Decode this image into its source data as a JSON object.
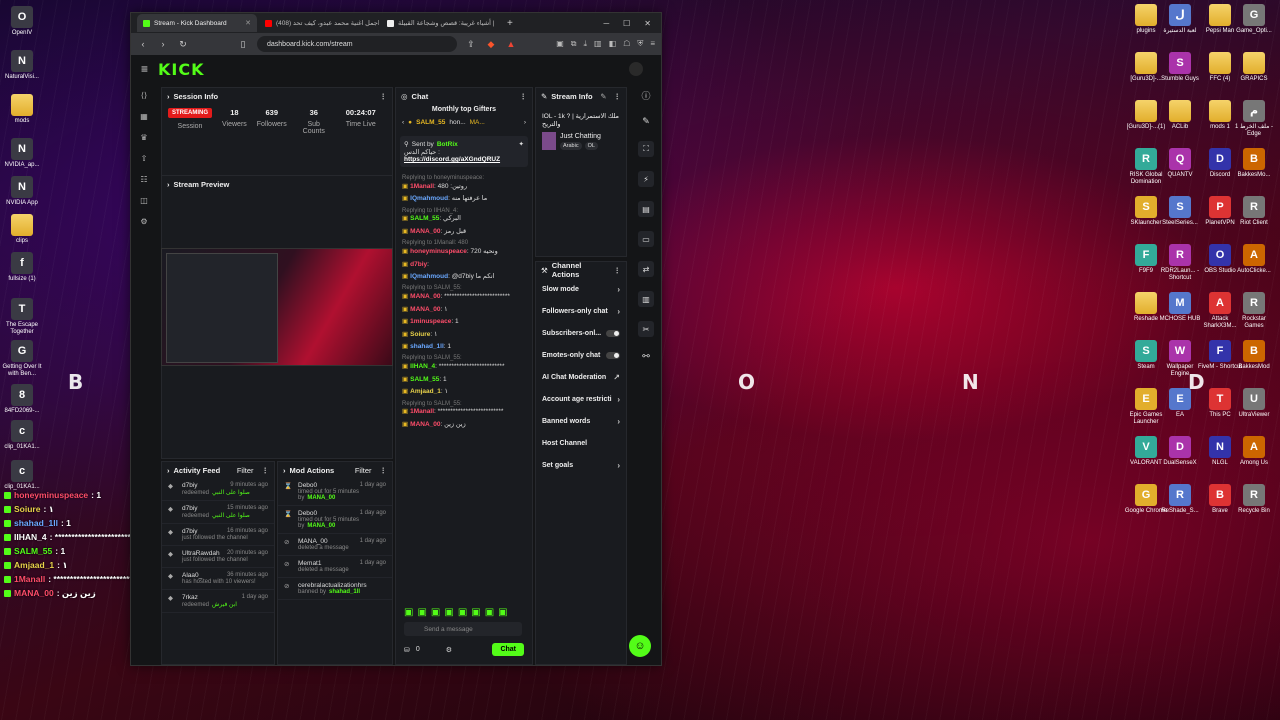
{
  "browser": {
    "tabs": [
      {
        "title": "Stream - Kick Dashboard",
        "favicon_color": "#53fc18",
        "active": true
      },
      {
        "title": "(408) اجمل اغنية محمد عبدو، كيف تحد",
        "favicon_color": "#ff0000",
        "active": false
      },
      {
        "title": "أشياء غريبة: قصص وشجاعة القبيلة |",
        "favicon_color": "#eeeeee",
        "active": false
      }
    ],
    "new_tab": "+",
    "url": "dashboard.kick.com/stream"
  },
  "kick": {
    "logo": "KICK",
    "session": {
      "title": "Session Info",
      "status": "STREAMING",
      "status_label": "Session",
      "viewers": "18",
      "viewers_label": "Viewers",
      "followers": "639",
      "followers_label": "Followers",
      "subs": "36",
      "subs_label": "Sub Counts",
      "time": "00:24:07",
      "time_label": "Time Live"
    },
    "preview_title": "Stream Preview",
    "activity": {
      "title": "Activity Feed",
      "filter": "Filter",
      "rows": [
        {
          "user": "d7biy",
          "text": "redeemed",
          "extra": "صلوا على النبي",
          "meta": "9 minutes ago"
        },
        {
          "user": "d7biy",
          "text": "redeemed",
          "extra": "صلوا على النبي",
          "meta": "15 minutes ago"
        },
        {
          "user": "d7biy",
          "text": "just followed the channel",
          "extra": "",
          "meta": "16 minutes ago"
        },
        {
          "user": "UltraRawdah",
          "text": "just followed the channel",
          "extra": "",
          "meta": "20 minutes ago"
        },
        {
          "user": "Alaa0_",
          "text": "has hosted with 10 viewers!",
          "extra": "",
          "meta": "36 minutes ago"
        },
        {
          "user": "7rkaz",
          "text": "redeemed",
          "extra": "ابن فيرش",
          "meta": "1 day ago"
        }
      ]
    },
    "mod": {
      "title": "Mod Actions",
      "filter": "Filter",
      "rows": [
        {
          "user": "Debo0",
          "text": "timed out for 5 minutes by",
          "by": "MANA_00",
          "meta": "1 day ago"
        },
        {
          "user": "Debo0",
          "text": "timed out for 5 minutes by",
          "by": "MANA_00",
          "meta": "1 day ago"
        },
        {
          "user": "MANA_00",
          "text": "deleted a message",
          "by": "",
          "meta": "1 day ago"
        },
        {
          "user": "Memat1",
          "text": "deleted a message",
          "by": "",
          "meta": "1 day ago"
        },
        {
          "user": "cerebralactualizationhrs",
          "text": "banned by",
          "by": "shahad_1ll",
          "meta": ""
        }
      ]
    },
    "chat": {
      "title": "Chat",
      "gifters_title": "Monthly top Gifters",
      "gifters": [
        "SALM_55",
        "hon...",
        "MA..."
      ],
      "pinned_by": "Sent by",
      "pinned_user": "BotRix",
      "pinned_text": "حياكم الدس :",
      "pinned_link": "https://discord.gg/aXGndQRUZ",
      "messages": [
        {
          "reply": "Replying to honeyminuspeace:",
          "user": "1Manall",
          "cls": "u-red",
          "text": "480 :روتين"
        },
        {
          "reply": "",
          "user": "IQmahmoud",
          "cls": "u-blue",
          "text": "ما عرفتها منه"
        },
        {
          "reply": "Replying to IIHAN_4:",
          "user": "SALM_55",
          "cls": "u-green",
          "text": "البركي"
        },
        {
          "reply": "",
          "user": "MANA_00",
          "cls": "u-red",
          "text": "قبل رمز"
        },
        {
          "reply": "Replying to 1Manall: 480",
          "user": "honeyminuspeace",
          "cls": "u-red",
          "text": "720 ونحيه"
        },
        {
          "reply": "",
          "user": "d7biy",
          "cls": "u-red",
          "text": ""
        },
        {
          "reply": "",
          "user": "IQmahmoud",
          "cls": "u-blue",
          "text": "@d7biy انكم ما"
        },
        {
          "reply": "Replying to SALM_55:",
          "user": "MANA_00",
          "cls": "u-red",
          "text": "**************************"
        },
        {
          "reply": "",
          "user": "MANA_00",
          "cls": "u-red",
          "text": "١"
        },
        {
          "reply": "",
          "user": "1minuspeace",
          "cls": "u-red",
          "text": "1"
        },
        {
          "reply": "",
          "user": "Soiure",
          "cls": "u-yellow",
          "text": "١"
        },
        {
          "reply": "",
          "user": "shahad_1ll",
          "cls": "u-blue",
          "text": "1"
        },
        {
          "reply": "Replying to SALM_55:",
          "user": "IIHAN_4",
          "cls": "u-green",
          "text": "**************************"
        },
        {
          "reply": "",
          "user": "SALM_55",
          "cls": "u-green",
          "text": "1"
        },
        {
          "reply": "",
          "user": "Amjaad_1",
          "cls": "u-yellow",
          "text": "١"
        },
        {
          "reply": "Replying to SALM_55:",
          "user": "1Manall",
          "cls": "u-red",
          "text": "**************************"
        },
        {
          "reply": "",
          "user": "MANA_00",
          "cls": "u-red",
          "text": "زين زين"
        }
      ],
      "input_placeholder": "Send a message",
      "points": "0",
      "send_label": "Chat"
    },
    "stream_info": {
      "title": "Stream Info",
      "stream_title": "IOL - 1k ? | ملك الاستمرارية",
      "stream_sub": "والتريح",
      "category": "Just Chatting",
      "tags": [
        "Arabic",
        "OL"
      ]
    },
    "channel_actions": {
      "title": "Channel Actions",
      "items": [
        {
          "label": "Slow mode",
          "control": "chevron"
        },
        {
          "label": "Followers-only chat",
          "control": "chevron"
        },
        {
          "label": "Subscribers-onl...",
          "control": "toggle"
        },
        {
          "label": "Emotes-only chat",
          "control": "toggle"
        },
        {
          "label": "AI Chat Moderation",
          "control": "link"
        },
        {
          "label": "Account age restricti",
          "control": "chevron"
        },
        {
          "label": "Banned words",
          "control": "chevron"
        },
        {
          "label": "Host Channel",
          "control": "none"
        },
        {
          "label": "Set goals",
          "control": "chevron"
        }
      ]
    }
  },
  "desktop": {
    "left_icons": [
      "OpenIV",
      "NaturalVisi...",
      "mods",
      "NVIDIA_ap...",
      "NVIDIA App",
      "clips",
      "fullsize (1)",
      "The Escape Together",
      "Getting Over It with Ben...",
      "84FD2069-...",
      "clip_01KA1...",
      "clip_01KA1..."
    ],
    "right_icons": [
      "plugins",
      "لعبة الدستيرة",
      "Pepsi Man",
      "Game_Opti...",
      "[Guru3D]-...",
      "Stumble Guys",
      "FFC (4)",
      "GRAPICS",
      "[Guru3D]-...(1)",
      "ACLib",
      "mods 1",
      "ملف الخرط 1 - Edge",
      "RISK Global Domination",
      "QUANTV",
      "Discord",
      "BakkesMo...",
      "SKlauncher",
      "SteelSeries...",
      "PlanetVPN",
      "Riot Client",
      "F9F9",
      "RDR2Laun... - Shortcut",
      "OBS Studio",
      "AutoClicke...",
      "Reshade",
      "MCHOSE HUB",
      "Attack SharkX3M...",
      "Rockstar Games",
      "Steam",
      "Wallpaper Engine",
      "FiveM - Shortcut",
      "BakkesMod",
      "Epic Games Launcher",
      "EA",
      "This PC",
      "UltraViewer",
      "VALORANT",
      "DualSenseX",
      "NLGL",
      "Among Us",
      "Google Chrome",
      "ReShade_S...",
      "Brave",
      "Recycle Bin"
    ],
    "wall_letters": [
      "B",
      "O",
      "N",
      "D"
    ]
  },
  "overlay": {
    "lines": [
      {
        "user": "honeyminuspeace",
        "text": ": 1"
      },
      {
        "user": "Soiure",
        "text": ": ١"
      },
      {
        "user": "shahad_1ll",
        "text": ": 1"
      },
      {
        "user": "IIHAN_4",
        "text": ": **************************"
      },
      {
        "user": "SALM_55",
        "text": ": 1"
      },
      {
        "user": "Amjaad_1",
        "text": ": ١"
      },
      {
        "user": "1Manall",
        "text": ": **************************"
      },
      {
        "user": "MANA_00",
        "text": ": زين زين"
      }
    ]
  }
}
